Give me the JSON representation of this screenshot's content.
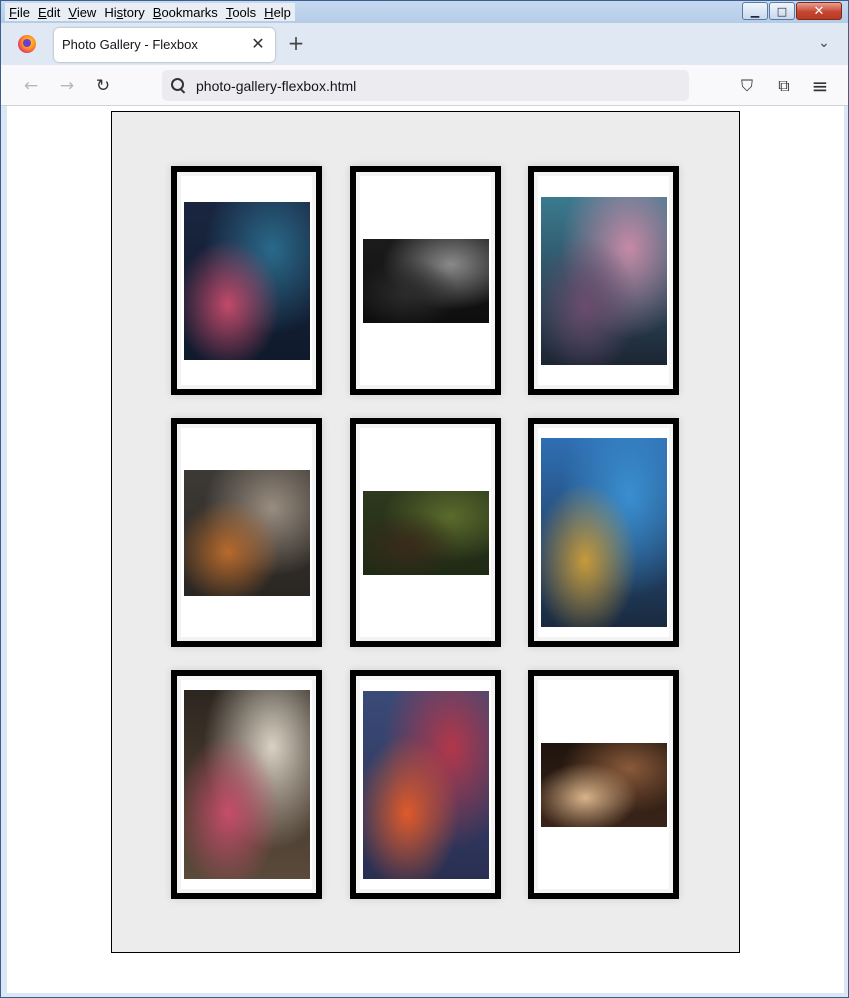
{
  "menu": {
    "items": [
      {
        "first": "F",
        "rest": "ile"
      },
      {
        "first": "E",
        "rest": "dit"
      },
      {
        "first": "V",
        "rest": "iew"
      },
      {
        "first": "",
        "pre": "Hi",
        "key": "s",
        "rest": "tory"
      },
      {
        "first": "B",
        "rest": "ookmarks"
      },
      {
        "first": "T",
        "rest": "ools"
      },
      {
        "first": "H",
        "rest": "elp"
      }
    ]
  },
  "window_controls": {
    "minimize": "▁",
    "maximize": "□",
    "close": "✕"
  },
  "tab": {
    "title": "Photo Gallery - Flexbox",
    "close_icon": "✕"
  },
  "tabstrip": {
    "new_tab_icon": "+",
    "list_tabs_icon": "⌄"
  },
  "nav": {
    "back_icon": "←",
    "forward_icon": "→",
    "reload_icon": "↻"
  },
  "urlbar": {
    "text": "photo-gallery-flexbox.html"
  },
  "toolbar": {
    "pocket_icon": "⛉",
    "extensions_icon": "⧉",
    "menu_icon": "≡"
  },
  "gallery": {
    "photos": [
      {
        "name": "night-street-photo",
        "orientation": "portrait",
        "colors": [
          "#1a2540",
          "#2a6a8a",
          "#c24a6a",
          "#0f1a2c"
        ]
      },
      {
        "name": "cat-photo",
        "orientation": "landscape",
        "colors": [
          "#1b1b1b",
          "#8a8a8a",
          "#2c2c2c",
          "#0e0e0e"
        ]
      },
      {
        "name": "stadium-sunset-photo",
        "orientation": "portrait",
        "colors": [
          "#3b7a8f",
          "#c68aa6",
          "#6b4c6e",
          "#1d2533"
        ]
      },
      {
        "name": "dachshund-photo",
        "orientation": "landscape",
        "colors": [
          "#3d3a36",
          "#9a8d80",
          "#b86a2c",
          "#2a2622"
        ]
      },
      {
        "name": "camping-mugs-photo",
        "orientation": "landscape",
        "colors": [
          "#2e3a1e",
          "#5a6b2c",
          "#3a2a1a",
          "#1f2a15"
        ]
      },
      {
        "name": "city-bridge-dusk-photo",
        "orientation": "portrait",
        "colors": [
          "#2f6fb4",
          "#3a8fd0",
          "#c79a3a",
          "#1a2a3f"
        ]
      },
      {
        "name": "flower-bouquet-photo",
        "orientation": "portrait",
        "colors": [
          "#2d2620",
          "#d9d2c4",
          "#c64d6a",
          "#5a4a3a"
        ]
      },
      {
        "name": "red-sunset-clouds-photo",
        "orientation": "portrait",
        "colors": [
          "#3a4b78",
          "#b3374a",
          "#e05a2a",
          "#2a2f52"
        ]
      },
      {
        "name": "spiral-staircase-photo",
        "orientation": "landscape",
        "colors": [
          "#1f140e",
          "#8a5a3a",
          "#d9b48a",
          "#3a2418"
        ]
      }
    ]
  }
}
